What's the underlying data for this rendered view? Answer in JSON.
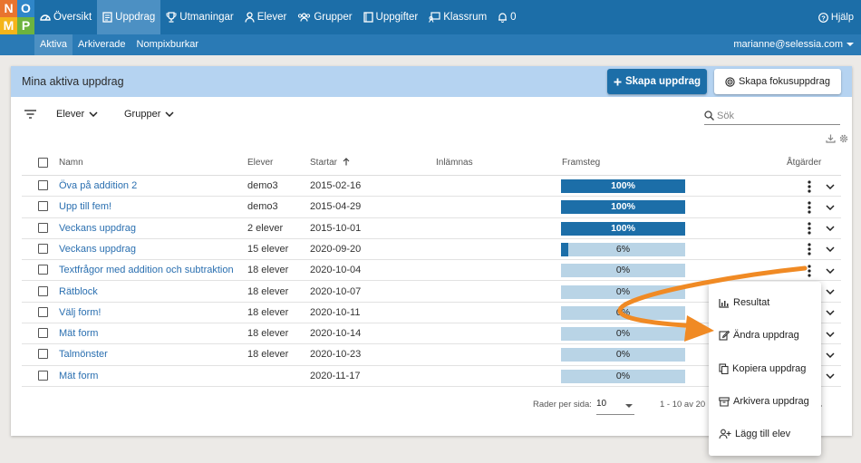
{
  "logo": {
    "letters": [
      "N",
      "O",
      "M",
      "P"
    ]
  },
  "nav": {
    "items": [
      {
        "label": "Översikt",
        "icon": "dashboard-icon"
      },
      {
        "label": "Uppdrag",
        "icon": "assignment-icon",
        "active": true
      },
      {
        "label": "Utmaningar",
        "icon": "trophy-icon"
      },
      {
        "label": "Elever",
        "icon": "person-icon"
      },
      {
        "label": "Grupper",
        "icon": "group-icon"
      },
      {
        "label": "Uppgifter",
        "icon": "book-icon"
      },
      {
        "label": "Klassrum",
        "icon": "classroom-icon"
      },
      {
        "label": "0",
        "icon": "bell-icon"
      }
    ],
    "help_label": "Hjälp"
  },
  "subnav": {
    "items": [
      "Aktiva",
      "Arkiverade",
      "Nompixburkar"
    ],
    "active": "Aktiva",
    "user_email": "marianne@selessia.com"
  },
  "card": {
    "title": "Mina aktiva uppdrag",
    "create_button": "Skapa uppdrag",
    "focus_button": "Skapa fokusuppdrag"
  },
  "filters": {
    "students_label": "Elever",
    "groups_label": "Grupper",
    "search_placeholder": "Sök"
  },
  "table": {
    "headers": {
      "name": "Namn",
      "students": "Elever",
      "starts": "Startar",
      "due": "Inlämnas",
      "progress": "Framsteg",
      "actions": "Åtgärder"
    },
    "rows": [
      {
        "name": "Öva på addition 2",
        "students": "demo3",
        "starts": "2015-02-16",
        "progress_label": "100%",
        "progress": 100
      },
      {
        "name": "Upp till fem!",
        "students": "demo3",
        "starts": "2015-04-29",
        "progress_label": "100%",
        "progress": 100
      },
      {
        "name": "Veckans uppdrag",
        "students": "2 elever",
        "starts": "2015-10-01",
        "progress_label": "100%",
        "progress": 100
      },
      {
        "name": "Veckans uppdrag",
        "students": "15 elever",
        "starts": "2020-09-20",
        "progress_label": "6%",
        "progress": 6
      },
      {
        "name": "Textfrågor med addition och subtraktion",
        "students": "18 elever",
        "starts": "2020-10-04",
        "progress_label": "0%",
        "progress": 0
      },
      {
        "name": "Rätblock",
        "students": "18 elever",
        "starts": "2020-10-07",
        "progress_label": "0%",
        "progress": 0
      },
      {
        "name": "Välj form!",
        "students": "18 elever",
        "starts": "2020-10-11",
        "progress_label": "0%",
        "progress": 0
      },
      {
        "name": "Mät form",
        "students": "18 elever",
        "starts": "2020-10-14",
        "progress_label": "0%",
        "progress": 0
      },
      {
        "name": "Talmönster",
        "students": "18 elever",
        "starts": "2020-10-23",
        "progress_label": "0%",
        "progress": 0
      },
      {
        "name": "Mät form",
        "students": "",
        "starts": "2020-11-17",
        "progress_label": "0%",
        "progress": 0
      }
    ]
  },
  "pagination": {
    "rows_per_page_label": "Rader per sida:",
    "rows_per_page": "10",
    "range": "1 - 10 av 20"
  },
  "context_menu": {
    "items": [
      {
        "label": "Resultat",
        "icon": "chart-icon"
      },
      {
        "label": "Ändra uppdrag",
        "icon": "edit-icon"
      },
      {
        "label": "Kopiera uppdrag",
        "icon": "copy-icon"
      },
      {
        "label": "Arkivera uppdrag",
        "icon": "archive-icon"
      },
      {
        "label": "Lägg till elev",
        "icon": "add-person-icon"
      }
    ]
  },
  "colors": {
    "primary": "#1c6ea8",
    "header_bg": "#b5d3f1",
    "progress_track": "#b9d4e6",
    "annotation_arrow": "#f08a24"
  }
}
